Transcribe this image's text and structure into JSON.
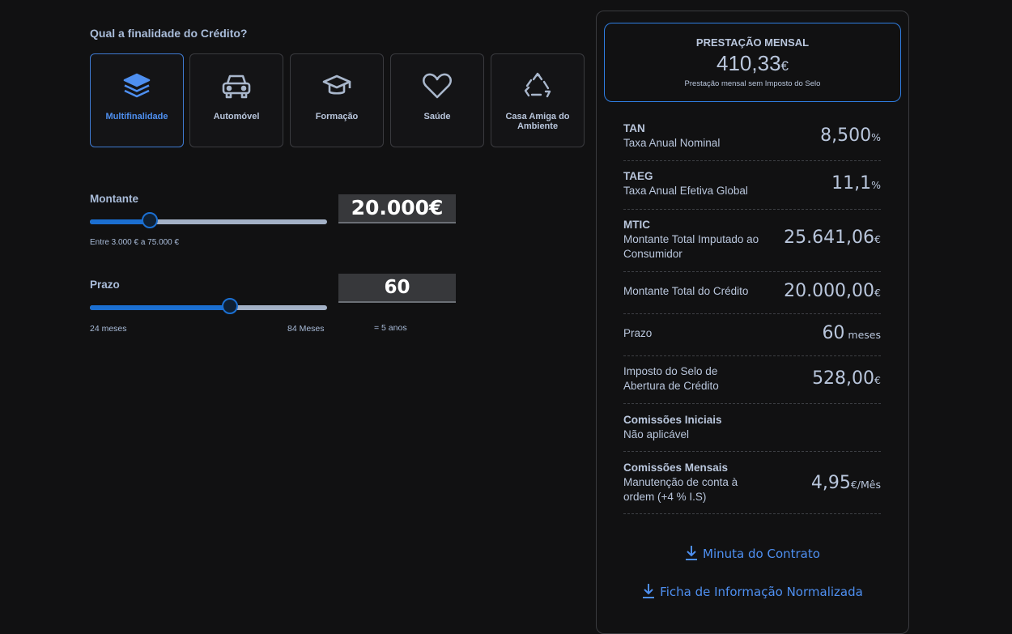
{
  "question": "Qual a finalidade do Crédito?",
  "purposes": [
    {
      "label": "Multifinalidade",
      "icon": "layers-icon",
      "selected": true
    },
    {
      "label": "Automóvel",
      "icon": "car-icon",
      "selected": false
    },
    {
      "label": "Formação",
      "icon": "graduation-cap-icon",
      "selected": false
    },
    {
      "label": "Saúde",
      "icon": "heart-icon",
      "selected": false
    },
    {
      "label": "Casa Amiga do Ambiente",
      "icon": "recycle-icon",
      "selected": false
    }
  ],
  "amount": {
    "label": "Montante",
    "value": "20.000€",
    "range_text": "Entre 3.000 € a 75.000 €",
    "slider_fraction": 0.254
  },
  "term": {
    "label": "Prazo",
    "value": "60",
    "min_label": "24 meses",
    "max_label": "84 Meses",
    "years_text": "= 5 anos",
    "slider_fraction": 0.591
  },
  "summary": {
    "monthly_title": "PRESTAÇÃO MENSAL",
    "monthly_value": "410,33",
    "monthly_currency": "€",
    "monthly_note": "Prestação mensal sem Imposto do Selo",
    "rows": [
      {
        "title": "TAN",
        "subtitle": "Taxa Anual Nominal",
        "value": "8,500",
        "unit": "%"
      },
      {
        "title": "TAEG",
        "subtitle": "Taxa Anual Efetiva Global",
        "value": "11,1",
        "unit": "%"
      },
      {
        "title": "MTIC",
        "subtitle": "Montante Total Imputado ao Consumidor",
        "value": "25.641,06",
        "unit": "€"
      },
      {
        "title": "",
        "subtitle": "Montante Total do Crédito",
        "value": "20.000,00",
        "unit": "€"
      },
      {
        "title": "",
        "subtitle": "Prazo",
        "value": "60",
        "unit": " meses"
      },
      {
        "title": "",
        "subtitle": "Imposto do Selo de Abertura de Crédito",
        "value": "528,00",
        "unit": "€"
      },
      {
        "title": "Comissões Iniciais",
        "subtitle": "Não aplicável",
        "value": "",
        "unit": ""
      },
      {
        "title": "Comissões Mensais",
        "subtitle": "Manutenção de conta à ordem (+4 % I.S)",
        "value": "4,95",
        "unit": "€/Mês"
      }
    ]
  },
  "downloads": {
    "contract": "Minuta do Contrato",
    "fin": "Ficha de Informação Normalizada"
  },
  "colors": {
    "accent": "#2f7ee3",
    "background": "#111112"
  }
}
